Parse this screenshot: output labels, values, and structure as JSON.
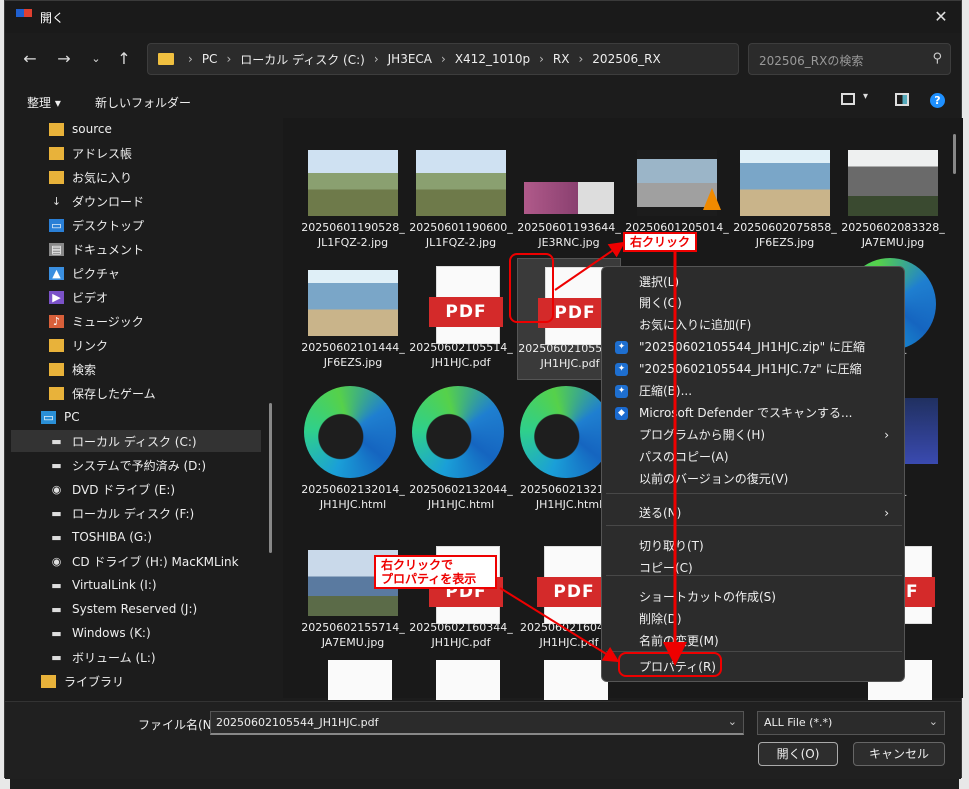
{
  "window": {
    "title": "開く"
  },
  "address": {
    "crumbs": [
      "PC",
      "ローカル ディスク (C:)",
      "JH3ECA",
      "X412_1010p",
      "RX",
      "202506_RX"
    ]
  },
  "search": {
    "placeholder": "202506_RXの検索"
  },
  "toolbar": {
    "organize": "整理 ▾",
    "new_folder": "新しいフォルダー"
  },
  "sidebar": {
    "items": [
      {
        "label": "source",
        "icon": "folder-icon"
      },
      {
        "label": "アドレス帳",
        "icon": "folder-icon"
      },
      {
        "label": "お気に入り",
        "icon": "folder-icon"
      },
      {
        "label": "ダウンロード",
        "icon": "download-icon"
      },
      {
        "label": "デスクトップ",
        "icon": "desktop-icon"
      },
      {
        "label": "ドキュメント",
        "icon": "document-icon"
      },
      {
        "label": "ピクチャ",
        "icon": "pictures-icon"
      },
      {
        "label": "ビデオ",
        "icon": "video-icon"
      },
      {
        "label": "ミュージック",
        "icon": "music-icon"
      },
      {
        "label": "リンク",
        "icon": "folder-icon"
      },
      {
        "label": "検索",
        "icon": "folder-icon"
      },
      {
        "label": "保存したゲーム",
        "icon": "folder-icon"
      },
      {
        "label": "PC",
        "icon": "pc-icon"
      },
      {
        "label": "ローカル ディスク (C:)",
        "icon": "drive-icon"
      },
      {
        "label": "システムで予約済み (D:)",
        "icon": "drive-icon"
      },
      {
        "label": "DVD ドライブ (E:)",
        "icon": "dvd-icon"
      },
      {
        "label": "ローカル ディスク (F:)",
        "icon": "drive-icon"
      },
      {
        "label": "TOSHIBA (G:)",
        "icon": "drive-icon"
      },
      {
        "label": "CD ドライブ (H:) MacKMLink",
        "icon": "cd-icon"
      },
      {
        "label": "VirtualLink (I:)",
        "icon": "drive-icon"
      },
      {
        "label": "System Reserved (J:)",
        "icon": "drive-icon"
      },
      {
        "label": "Windows (K:)",
        "icon": "drive-icon"
      },
      {
        "label": "ボリューム (L:)",
        "icon": "drive-icon"
      },
      {
        "label": "ライブラリ",
        "icon": "library-icon"
      }
    ]
  },
  "files": [
    {
      "l1": "20250601190528_",
      "l2": "JL1FQZ-2.jpg",
      "kind": "photo-field"
    },
    {
      "l1": "20250601190600_",
      "l2": "JL1FQZ-2.jpg",
      "kind": "photo-field"
    },
    {
      "l1": "20250601193644_",
      "l2": "JE3RNC.jpg",
      "kind": "photo-flowers"
    },
    {
      "l1": "20250601205014_",
      "l2": "",
      "kind": "video"
    },
    {
      "l1": "20250602075858_",
      "l2": "JF6EZS.jpg",
      "kind": "photo-people"
    },
    {
      "l1": "20250602083328_",
      "l2": "JA7EMU.jpg",
      "kind": "photo-train"
    },
    {
      "l1": "20250602101444_",
      "l2": "JF6EZS.jpg",
      "kind": "photo-people"
    },
    {
      "l1": "20250602105514_",
      "l2": "JH1HJC.pdf",
      "kind": "pdf"
    },
    {
      "l1": "20250602105544_",
      "l2": "JH1HJC.pdf",
      "kind": "pdf"
    },
    {
      "l1": "944_",
      "l2": "ml",
      "kind": "edge-partial"
    },
    {
      "l1": "20250602132014_",
      "l2": "JH1HJC.html",
      "kind": "edge"
    },
    {
      "l1": "20250602132044_",
      "l2": "JH1HJC.html",
      "kind": "edge"
    },
    {
      "l1": "20250602132114",
      "l2": "JH1HJC.html",
      "kind": "edge"
    },
    {
      "l1": "314_",
      "l2": "jpg",
      "kind": "photo-partial"
    },
    {
      "l1": "20250602155714_",
      "l2": "JA7EMU.jpg",
      "kind": "photo-tower"
    },
    {
      "l1": "20250602160344_",
      "l2": "JH1HJC.pdf",
      "kind": "pdf"
    },
    {
      "l1": "20250602160414",
      "l2": "JH1HJC.pdf",
      "kind": "pdf"
    },
    {
      "l1": "34_",
      "l2": "df",
      "kind": "pdf-partial"
    }
  ],
  "pdf_label": "PDF",
  "context_menu": {
    "items": [
      "選択(L)",
      "開く(O)",
      "お気に入りに追加(F)",
      "\"20250602105544_JH1HJC.zip\" に圧縮",
      "\"20250602105544_JH1HJC.7z\" に圧縮",
      "圧縮(B)...",
      "Microsoft Defender でスキャンする...",
      "プログラムから開く(H)",
      "パスのコピー(A)",
      "以前のバージョンの復元(V)",
      "送る(N)",
      "切り取り(T)",
      "コピー(C)",
      "ショートカットの作成(S)",
      "削除(D)",
      "名前の変更(M)",
      "プロパティ(R)"
    ]
  },
  "callouts": {
    "right_click": "右クリック",
    "right_click_props_1": "右クリックで",
    "right_click_props_2": "プロパティを表示"
  },
  "footer": {
    "filename_label": "ファイル名(N):",
    "filename_value": "20250602105544_JH1HJC.pdf",
    "filetype": "ALL File (*.*)",
    "open": "開く(O)",
    "cancel": "キャンセル"
  },
  "colors": {
    "accent": "#1e90ff",
    "annotation": "#e00000",
    "pdf_red": "#d42a2a"
  }
}
